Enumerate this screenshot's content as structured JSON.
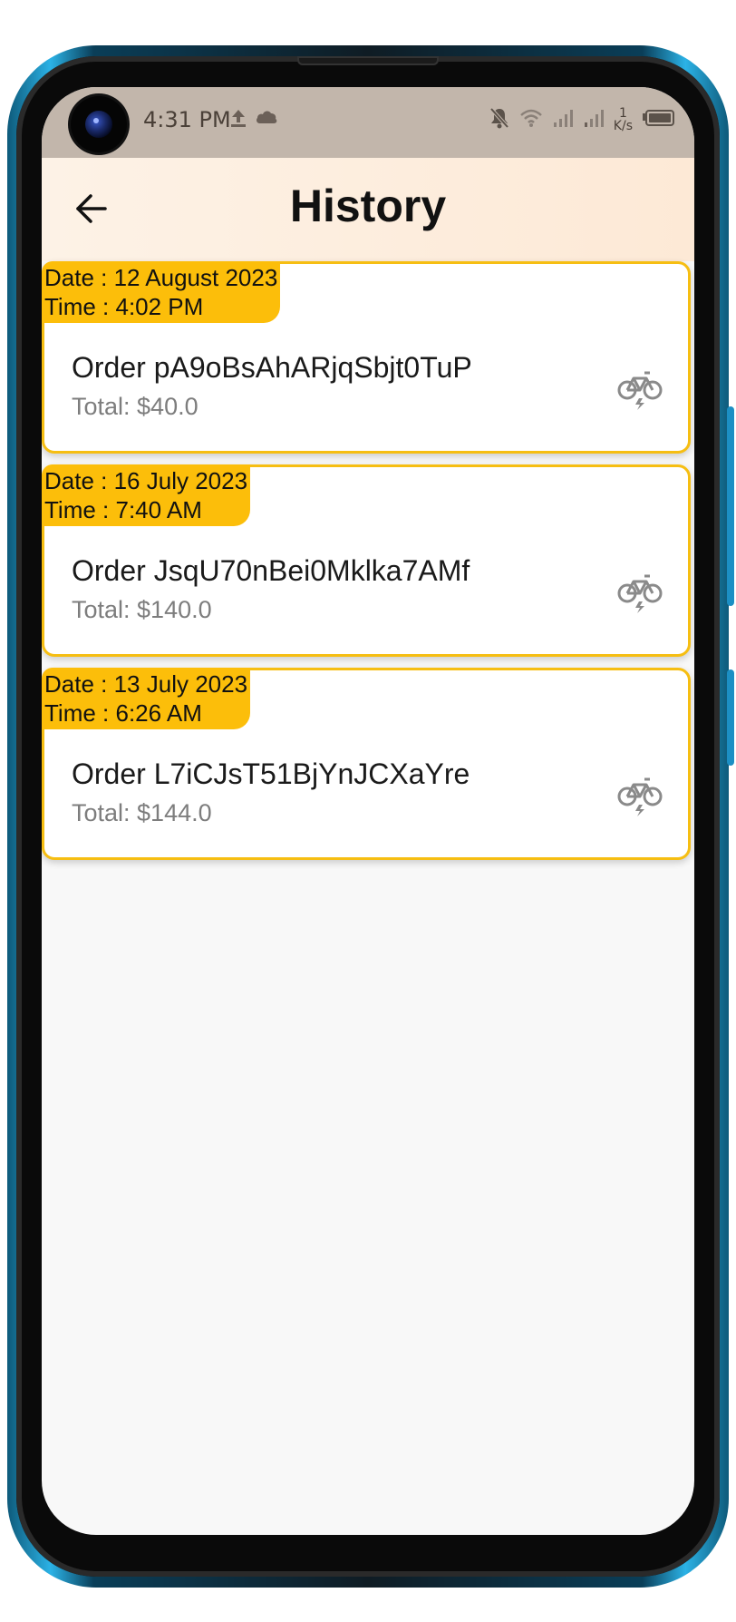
{
  "status_bar": {
    "time": "4:31 PM",
    "net_speed_value": "1",
    "net_speed_unit": "K/s"
  },
  "app_bar": {
    "title": "History"
  },
  "orders": [
    {
      "date_line": "Date : 12 August 2023",
      "time_line": "Time : 4:02 PM",
      "order": "Order pA9oBsAhARjqSbjt0TuP",
      "total": "Total: $40.0"
    },
    {
      "date_line": "Date : 16 July 2023",
      "time_line": "Time : 7:40 AM",
      "order": "Order JsqU70nBei0Mklka7AMf",
      "total": "Total: $140.0"
    },
    {
      "date_line": "Date : 13 July 2023",
      "time_line": "Time : 6:26 AM",
      "order": "Order L7iCJsT51BjYnJCXaYre",
      "total": "Total: $144.0"
    }
  ],
  "colors": {
    "accent": "#fcbe0a",
    "card_border": "#f6be12",
    "status_bar": "#c2b6ab",
    "app_bar": "#fdf2e6",
    "background": "#f8f8f8"
  },
  "icons": {
    "back": "arrow-left-icon",
    "order_type": "electric-bike-icon"
  }
}
